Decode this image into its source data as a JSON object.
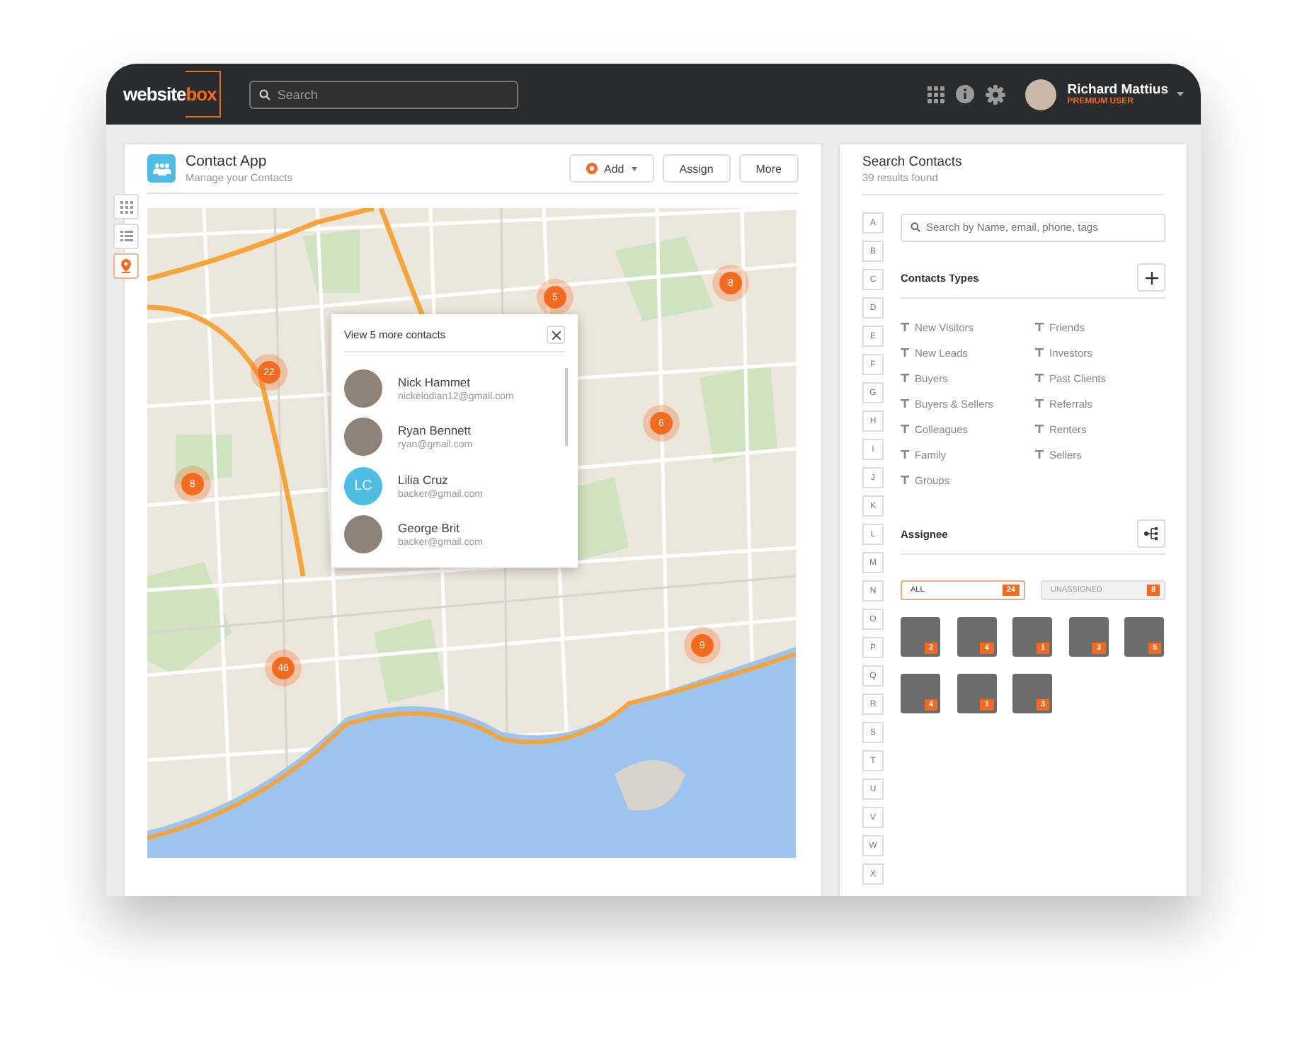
{
  "header": {
    "logo": {
      "primary": "website",
      "accent": "box"
    },
    "search": {
      "placeholder": "Search"
    },
    "user": {
      "name": "Richard Mattius",
      "role": "PREMIUM USER"
    }
  },
  "tools": [
    {
      "kind": "grid",
      "selected": false
    },
    {
      "kind": "list",
      "selected": false
    },
    {
      "kind": "map",
      "selected": true
    }
  ],
  "app": {
    "title": "Contact App",
    "subtitle": "Manage your Contacts",
    "buttons": [
      {
        "kind": "add",
        "label": "Add"
      },
      {
        "kind": "plain",
        "label": "Assign"
      },
      {
        "kind": "plain",
        "label": "More"
      }
    ]
  },
  "map": {
    "markers": [
      {
        "count": "22"
      },
      {
        "count": "5"
      },
      {
        "count": "8"
      },
      {
        "count": "8"
      },
      {
        "count": "6"
      },
      {
        "count": "46"
      },
      {
        "count": "9"
      }
    ],
    "popup": {
      "title": "View 5 more contacts",
      "contacts": [
        {
          "name": "Nick Hammet",
          "email": "nickelodian12@gmail.com",
          "kind": "photo"
        },
        {
          "name": "Ryan Bennett",
          "email": "ryan@gmail.com",
          "kind": "photo"
        },
        {
          "name": "Lilia Cruz",
          "email": "backer@gmail.com",
          "kind": "initials",
          "initials": "LC",
          "color": "#4dbde6"
        },
        {
          "name": "George Brit",
          "email": "backer@gmail.com",
          "kind": "photo"
        }
      ]
    }
  },
  "search_panel": {
    "title": "Search Contacts",
    "subtitle": "39 results found",
    "letters": [
      "A",
      "B",
      "C",
      "D",
      "E",
      "F",
      "G",
      "H",
      "I",
      "J",
      "K",
      "L",
      "M",
      "N",
      "O",
      "P",
      "Q",
      "R",
      "S",
      "T",
      "U",
      "V",
      "W",
      "X"
    ],
    "search": {
      "placeholder": "Search by Name, email, phone, tags"
    },
    "types_title": "Contacts Types",
    "types": [
      "New Visitors",
      "New Leads",
      "Buyers",
      "Buyers & Sellers",
      "Colleagues",
      "Family",
      "Groups",
      "Friends",
      "Investors",
      "Past Clients",
      "Referrals",
      "Renters",
      "Sellers"
    ],
    "assignee_title": "Assignee",
    "filters": [
      {
        "label": "ALL",
        "count": "24",
        "selected": true
      },
      {
        "label": "UNASSIGNED",
        "count": "8",
        "selected": false
      }
    ],
    "assignees": [
      {
        "count": "2"
      },
      {
        "count": "4"
      },
      {
        "count": "1"
      },
      {
        "count": "3"
      },
      {
        "count": "5"
      },
      {
        "count": "4"
      },
      {
        "count": "1"
      },
      {
        "count": "3"
      }
    ]
  }
}
